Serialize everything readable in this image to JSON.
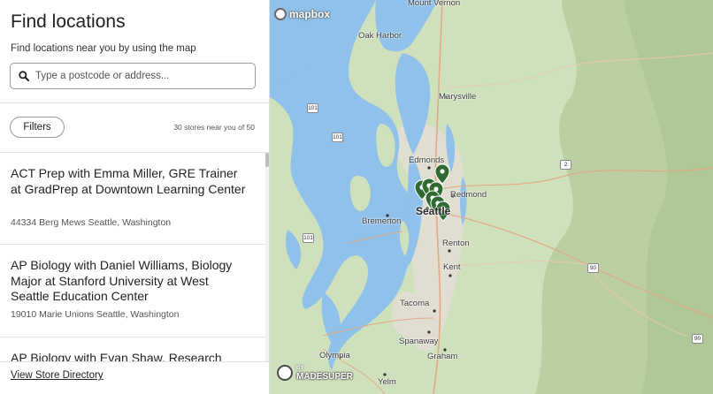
{
  "panel": {
    "title": "Find locations",
    "subtitle": "Find locations near you by using the map",
    "search_placeholder": "Type a postcode or address...",
    "filters_label": "Filters",
    "count_text": "30 stores near you of 50",
    "footer_link": "View Store Directory"
  },
  "locations": [
    {
      "name": "ACT Prep with Emma Miller, GRE Trainer at GradPrep at Downtown Learning Center",
      "address": "44334 Berg Mews Seattle, Washington"
    },
    {
      "name": "AP Biology with Daniel Williams, Biology Major at Stanford University at West Seattle Education Center",
      "address": "19010 Marie Unions Seattle, Washington"
    },
    {
      "name": "AP Biology with Evan Shaw, Research",
      "address": ""
    }
  ],
  "map": {
    "attribution": "mapbox",
    "credit_by": "BY",
    "credit": "MADESUPER",
    "places": [
      "Mount Vernon",
      "Oak Harbor",
      "Marysville",
      "Edmonds",
      "Redmond",
      "Seattle",
      "Bremerton",
      "Renton",
      "Kent",
      "Tacoma",
      "Spanaway",
      "Olympia",
      "Graham",
      "Yelm"
    ],
    "shields": [
      "101",
      "101",
      "101",
      "2",
      "90",
      "90"
    ],
    "colors": {
      "water": "#8fc1ea",
      "land": "#cfe0bd",
      "mountain": "#b9cca0",
      "urban": "#e4e0d6",
      "pin": "#2f6a31"
    }
  }
}
